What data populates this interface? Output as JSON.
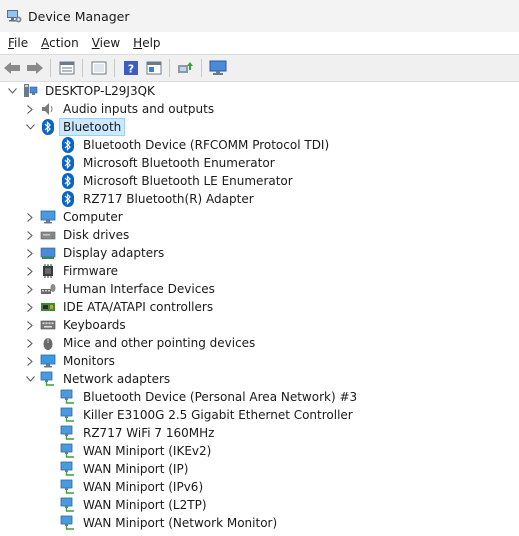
{
  "window": {
    "title": "Device Manager"
  },
  "menu": [
    {
      "label": "File",
      "key": "F",
      "rest": "ile"
    },
    {
      "label": "Action",
      "key": "A",
      "rest": "ction"
    },
    {
      "label": "View",
      "key": "V",
      "rest": "iew"
    },
    {
      "label": "Help",
      "key": "H",
      "rest": "elp"
    }
  ],
  "toolbar": [
    "back-icon",
    "forward-icon",
    "properties-icon",
    "update-driver-icon",
    "help-icon",
    "device-view-icon",
    "scan-hardware-icon",
    "monitor-icon"
  ],
  "tree": {
    "root": "DESKTOP-L29J3QK",
    "categories": [
      {
        "label": "Audio inputs and outputs",
        "icon": "speaker-icon",
        "expanded": false
      },
      {
        "label": "Bluetooth",
        "icon": "bluetooth-icon",
        "expanded": true,
        "selected": true,
        "children": [
          "Bluetooth Device (RFCOMM Protocol TDI)",
          "Microsoft Bluetooth Enumerator",
          "Microsoft Bluetooth LE Enumerator",
          "RZ717 Bluetooth(R) Adapter"
        ]
      },
      {
        "label": "Computer",
        "icon": "computer-icon",
        "expanded": false
      },
      {
        "label": "Disk drives",
        "icon": "disk-icon",
        "expanded": false
      },
      {
        "label": "Display adapters",
        "icon": "display-adapter-icon",
        "expanded": false
      },
      {
        "label": "Firmware",
        "icon": "firmware-icon",
        "expanded": false
      },
      {
        "label": "Human Interface Devices",
        "icon": "hid-icon",
        "expanded": false
      },
      {
        "label": "IDE ATA/ATAPI controllers",
        "icon": "ide-icon",
        "expanded": false
      },
      {
        "label": "Keyboards",
        "icon": "keyboard-icon",
        "expanded": false
      },
      {
        "label": "Mice and other pointing devices",
        "icon": "mouse-icon",
        "expanded": false
      },
      {
        "label": "Monitors",
        "icon": "monitor-icon",
        "expanded": false
      },
      {
        "label": "Network adapters",
        "icon": "network-icon",
        "expanded": true,
        "children": [
          "Bluetooth Device (Personal Area Network) #3",
          "Killer E3100G 2.5 Gigabit Ethernet Controller",
          "RZ717 WiFi 7 160MHz",
          "WAN Miniport (IKEv2)",
          "WAN Miniport (IP)",
          "WAN Miniport (IPv6)",
          "WAN Miniport (L2TP)",
          "WAN Miniport (Network Monitor)"
        ]
      }
    ]
  },
  "colors": {
    "accent": "#0a64c8",
    "selection_bg": "#cce8ff",
    "selection_border": "#99d1ff",
    "titlebar": "#f3f3f3"
  }
}
